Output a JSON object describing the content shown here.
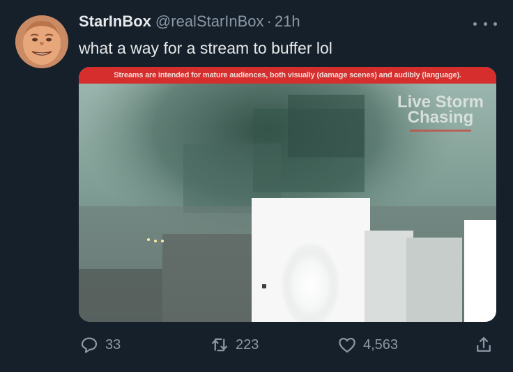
{
  "tweet": {
    "display_name": "StarInBox",
    "handle": "@realStarInBox",
    "separator": "·",
    "time": "21h",
    "text": "what a way for a stream to buffer lol"
  },
  "media": {
    "warning_text": "Streams are intended for mature audiences, both visually (damage scenes) and audibly (language).",
    "watermark_line1": "Live Storm",
    "watermark_line2": "Chasing",
    "warning_color": "#d62d2d"
  },
  "actions": {
    "reply_count": "33",
    "retweet_count": "223",
    "like_count": "4,563",
    "reply_icon": "speech-bubble-icon",
    "retweet_icon": "retweet-arrows-icon",
    "like_icon": "heart-icon",
    "share_icon": "share-upload-icon"
  },
  "colors": {
    "background": "#15202b",
    "primary_text": "#e7e9ea",
    "secondary_text": "#8b98a5"
  }
}
